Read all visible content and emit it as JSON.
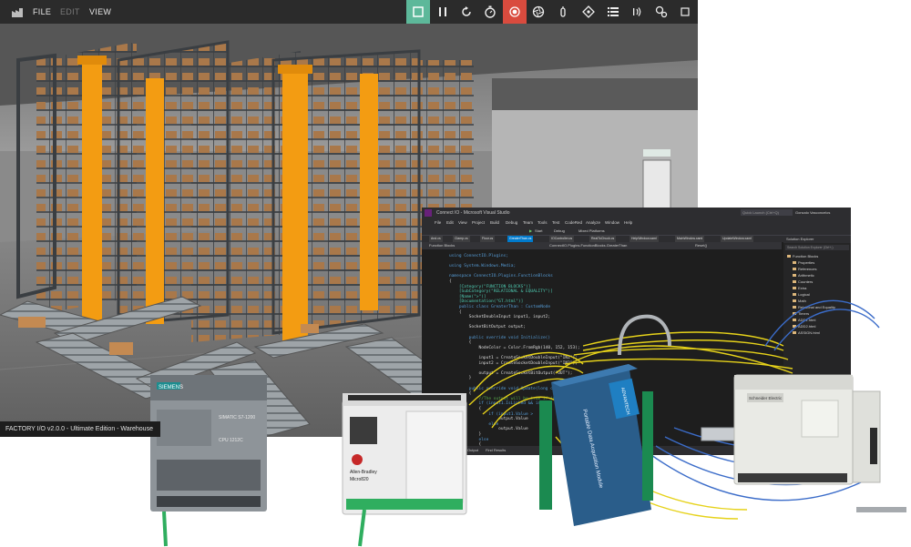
{
  "factoryio": {
    "menu": {
      "file": "FILE",
      "edit": "EDIT",
      "view": "VIEW"
    },
    "toolbar": [
      {
        "name": "select-icon",
        "state": "active"
      },
      {
        "name": "pause-icon",
        "state": "normal"
      },
      {
        "name": "reset-icon",
        "state": "normal"
      },
      {
        "name": "stopwatch-icon",
        "state": "normal"
      },
      {
        "name": "record-icon",
        "state": "alert"
      },
      {
        "name": "camera-icon",
        "state": "normal"
      },
      {
        "name": "touch-icon",
        "state": "normal"
      },
      {
        "name": "target-icon",
        "state": "normal"
      },
      {
        "name": "list-icon",
        "state": "normal"
      },
      {
        "name": "sensor-icon",
        "state": "normal"
      },
      {
        "name": "drivers-icon",
        "state": "normal"
      }
    ],
    "status": "FACTORY I/O v2.0.0 - Ultimate Edition - Warehouse",
    "colors": {
      "toolbar": "#2b2b2b",
      "active": "#5db89a",
      "alert": "#d94b3e",
      "rack_orange": "#f39c12"
    }
  },
  "visual_studio": {
    "title": "Connect IO - Microsoft Visual Studio",
    "quick_launch": "Quick Launch (Ctrl+Q)",
    "user": "Goncalo Vasconcelos",
    "menu": [
      "File",
      "Edit",
      "View",
      "Project",
      "Build",
      "Debug",
      "Team",
      "Tools",
      "Test",
      "CodeRed",
      "Analyze",
      "Window",
      "Help"
    ],
    "toolbar": {
      "start": "Start",
      "config": "Debug",
      "platform": "Mixed Platforms"
    },
    "tabs": [
      "And.cs",
      "Clamp.cs",
      "Floor.cs",
      "GreaterThan.cs",
      "IOController.cs",
      "RealToChuck.cs",
      "HelpWindow.xaml",
      "MainWindow.xaml",
      "UpdateWindow.xaml"
    ],
    "nav": {
      "left": "Function Blocks",
      "middle": "ConnectIO.Plugins.FunctionBlocks.GreaterThan",
      "right": "Reset()"
    },
    "code": [
      "using ConnectIO.Plugins;",
      "",
      "using System.Windows.Media;",
      "",
      "namespace ConnectIO.Plugins.FunctionBlocks",
      "{",
      "    [Category(\"FUNCTION BLOCKS\")]",
      "    [SubCategory(\"RELATIONAL & EQUALITY\")]",
      "    [Name(\">\")]",
      "    [Documentation(\"GT.html\")]",
      "    public class GreaterThan : CustomNode",
      "    {",
      "        SocketDoubleInput input1, input2;",
      "",
      "        SocketBitOutput output;",
      "",
      "        public override void Initialize()",
      "        {",
      "            NodeColor = Color.FromRgb(140, 152, 153);",
      "",
      "            input1 = CreateSocketDoubleInput(\"IN1\");",
      "            input2 = CreateSocketDoubleInput(\"IN2\");",
      "",
      "            output = CreateSocketBitOutput(\"OUT\");",
      "        }",
      "",
      "        public override void Update(long cycle)",
      "        {",
      "            //The output will be true if input 1 is greater",
      "            if (input1.IsLinked && input2",
      "            {",
      "                if (input1.Value >",
      "                    output.Value",
      "                else",
      "                    output.Value",
      "            }",
      "            else",
      "            {",
      "            }"
    ],
    "solution_explorer": {
      "title": "Solution Explorer",
      "search": "Search Solution Explorer (Ctrl+;)",
      "items": [
        "Function Blocks",
        "Properties",
        "References",
        "Arithmetic",
        "Counters",
        "Extra",
        "Logical",
        "Math",
        "Relational and Equality",
        "Timers",
        "ADD1.html",
        "ADD2.html",
        "ASSIGN.html"
      ]
    },
    "bottom_tabs": [
      "Output",
      "Find Results"
    ]
  },
  "hardware": {
    "siemens": {
      "brand": "SIEMENS",
      "model": "SIMATIC S7-1200",
      "cpu": "CPU 1212C"
    },
    "allen_bradley": {
      "brand": "Allen-Bradley",
      "model": "Micro820"
    },
    "advantech": {
      "brand": "ADVANTECH",
      "label": "Portable Data Acquisition Module"
    },
    "schneider": {
      "brand": "Schneider Electric"
    }
  }
}
